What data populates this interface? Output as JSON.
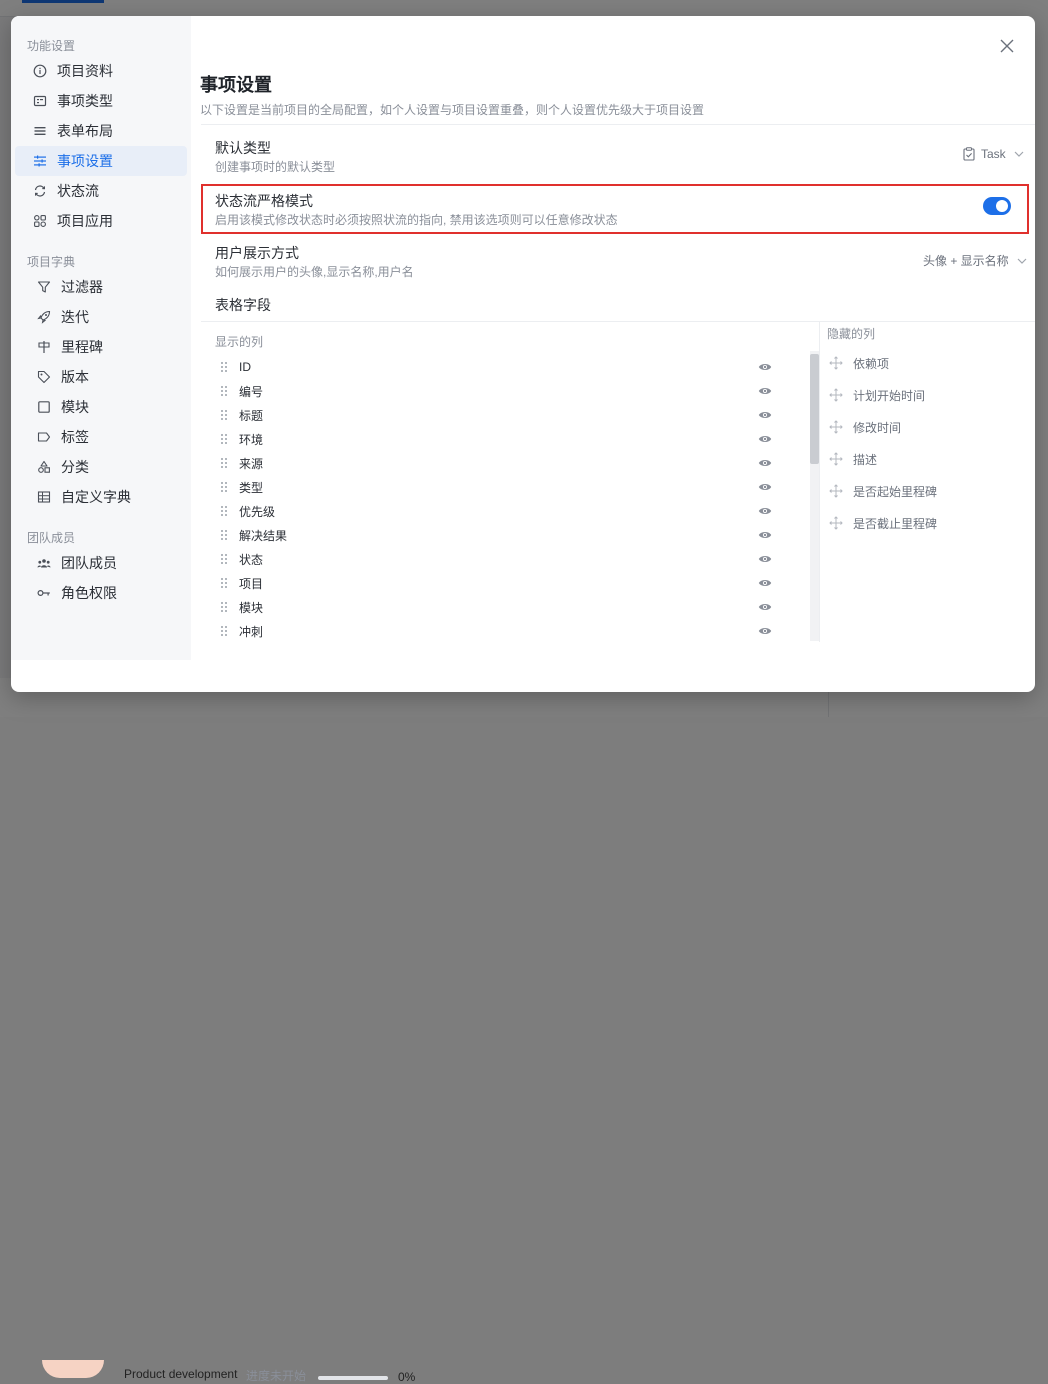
{
  "background": {
    "project_name": "Product development",
    "project_status": "进度未开始",
    "progress_percent": 0,
    "progress_text": "0%"
  },
  "sidebar": {
    "sections": [
      {
        "title": "功能设置",
        "items": [
          {
            "label": "项目资料",
            "icon": "info-icon"
          },
          {
            "label": "事项类型",
            "icon": "issue-type-icon"
          },
          {
            "label": "表单布局",
            "icon": "form-layout-icon"
          },
          {
            "label": "事项设置",
            "icon": "issue-settings-icon",
            "active": true
          },
          {
            "label": "状态流",
            "icon": "workflow-icon"
          },
          {
            "label": "项目应用",
            "icon": "apps-icon"
          }
        ]
      },
      {
        "title": "项目字典",
        "items": [
          {
            "label": "过滤器",
            "icon": "filter-icon"
          },
          {
            "label": "迭代",
            "icon": "rocket-icon"
          },
          {
            "label": "里程碑",
            "icon": "milestone-icon"
          },
          {
            "label": "版本",
            "icon": "tag-icon"
          },
          {
            "label": "模块",
            "icon": "module-icon"
          },
          {
            "label": "标签",
            "icon": "label-icon"
          },
          {
            "label": "分类",
            "icon": "category-icon"
          },
          {
            "label": "自定义字典",
            "icon": "table-icon"
          }
        ]
      },
      {
        "title": "团队成员",
        "items": [
          {
            "label": "团队成员",
            "icon": "team-icon"
          },
          {
            "label": "角色权限",
            "icon": "key-icon"
          }
        ]
      }
    ]
  },
  "main": {
    "title": "事项设置",
    "description": "以下设置是当前项目的全局配置，如个人设置与项目设置重叠，则个人设置优先级大于项目设置",
    "settings": {
      "default_type": {
        "title": "默认类型",
        "desc": "创建事项时的默认类型",
        "value": "Task"
      },
      "strict_workflow": {
        "title": "状态流严格模式",
        "desc": "启用该模式修改状态时必须按照状流的指向, 禁用该选项则可以任意修改状态",
        "enabled": true
      },
      "user_display": {
        "title": "用户展示方式",
        "desc": "如何展示用户的头像,显示名称,用户名",
        "value": "头像 + 显示名称"
      },
      "table_fields": {
        "title": "表格字段"
      }
    },
    "visible_columns_title": "显示的列",
    "visible_columns": [
      "ID",
      "编号",
      "标题",
      "环境",
      "来源",
      "类型",
      "优先级",
      "解决结果",
      "状态",
      "项目",
      "模块",
      "冲刺"
    ],
    "hidden_columns_title": "隐藏的列",
    "hidden_columns": [
      "依赖项",
      "计划开始时间",
      "修改时间",
      "描述",
      "是否起始里程碑",
      "是否截止里程碑"
    ]
  },
  "colors": {
    "accent": "#1d6fe8",
    "highlight_border": "#e0302d",
    "overlay": "rgba(0,0,0,0.5)"
  }
}
